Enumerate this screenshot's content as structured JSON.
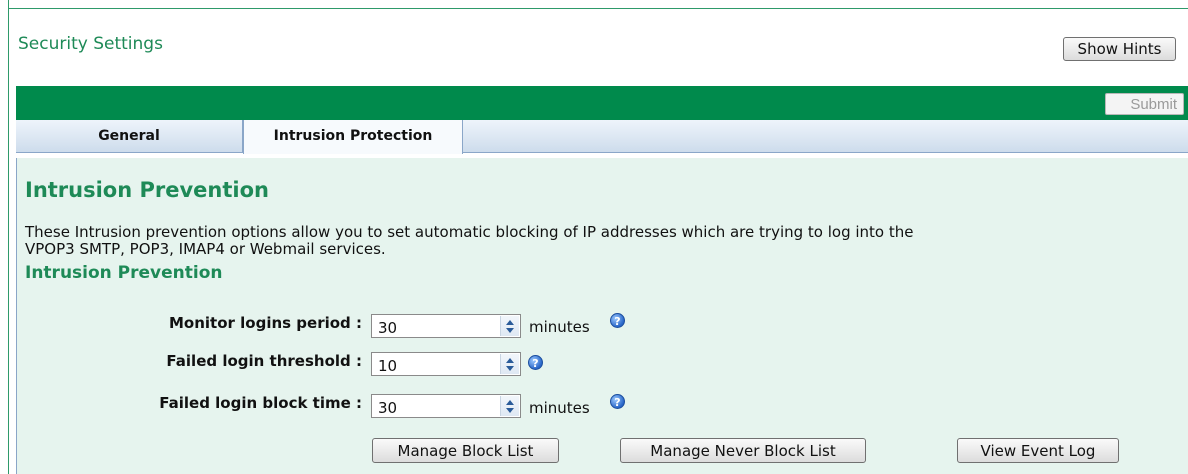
{
  "header": {
    "title": "Security Settings",
    "show_hints_label": "Show Hints"
  },
  "toolbar": {
    "submit_label": "Submit"
  },
  "tabs": [
    {
      "label": "General",
      "active": false
    },
    {
      "label": "Intrusion Protection",
      "active": true
    }
  ],
  "main": {
    "heading": "Intrusion Prevention",
    "description_line1": "These Intrusion prevention options allow you to set automatic blocking of IP addresses which are trying to log into the",
    "description_line2": "VPOP3 SMTP, POP3, IMAP4 or Webmail services.",
    "subheading": "Intrusion Prevention",
    "fields": [
      {
        "label": "Monitor logins period :",
        "value": "30",
        "unit": "minutes"
      },
      {
        "label": "Failed login threshold :",
        "value": "10",
        "unit": ""
      },
      {
        "label": "Failed login block time :",
        "value": "30",
        "unit": "minutes"
      }
    ],
    "help_icon_glyph": "?",
    "buttons": {
      "manage_block_list": "Manage Block List",
      "manage_never_block_list": "Manage Never Block List",
      "view_event_log": "View Event Log"
    }
  },
  "colors": {
    "brand_green": "#008a4c",
    "heading_green": "#1e8a57",
    "panel_bg": "#e6f4ee"
  }
}
